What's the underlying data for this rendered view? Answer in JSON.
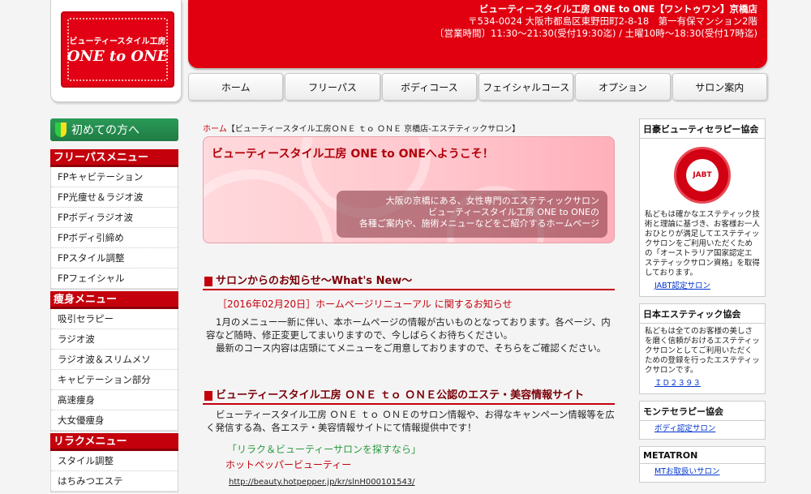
{
  "logo": {
    "sub": "ビューティースタイル工房",
    "main": "ONE to ONE"
  },
  "header": {
    "line1": "ビューティースタイル工房 ONE to ONE【ワントゥワン】京橋店",
    "line2": "〒534-0024 大阪市都島区東野田町2-8-18　第一有保マンション2階",
    "line3": "〔営業時間〕11:30～21:30(受付19:30迄) / 土曜10時～18:30(受付17時迄)"
  },
  "nav": [
    "ホーム",
    "フリーパス",
    "ボディコース",
    "フェイシャルコース",
    "オプション",
    "サロン案内"
  ],
  "sidebar": {
    "first_time": "初めての方へ",
    "menus": [
      {
        "title": "フリーパスメニュー",
        "items": [
          "FPキャビテーション",
          "FP光痩せ＆ラジオ波",
          "FPボディラジオ波",
          "FPボディ引締め",
          "FPスタイル調整",
          "FPフェイシャル"
        ]
      },
      {
        "title": "痩身メニュー",
        "items": [
          "吸引セラピー",
          "ラジオ波",
          "ラジオ波＆スリムメソ",
          "キャビテーション部分",
          "高速痩身",
          "大女優痩身"
        ]
      },
      {
        "title": "リラクメニュー",
        "items": [
          "スタイル調整",
          "はちみつエステ"
        ]
      }
    ]
  },
  "main": {
    "breadcrumb_home": "ホーム",
    "breadcrumb_rest": "【ビューティースタイル工房ＯＮＥ ｔｏ ＯＮＥ 京橋店-エステティックサロン】",
    "welcome_title": "ビューティースタイル工房 ONE to ONEへようこそ！",
    "welcome_lines": [
      "大阪の京橋にある、女性専門のエステティックサロン",
      "ビューティースタイル工房 ONE to ONEの",
      "各種ご案内や、施術メニューなどをご紹介するホームページ"
    ],
    "news_title": "サロンからのお知らせ～What's New～",
    "news_head": "［2016年02月20日］ホームページリニューアル に関するお知らせ",
    "news_body": [
      "1月のメニュー一新に伴い、本ホームページの情報が古いものとなっております。各ページ、内容など随時、修正変更してまいりますので、今しばらくお待ちください。",
      "最新のコース内容は店頭にてメニューをご用意しておりますので、そちらをご確認ください。"
    ],
    "info_title": "ビューティースタイル工房 ＯＮＥ ｔｏ ＯＮＥ公認のエステ・美容情報サイト",
    "info_body": "ビューティースタイル工房 ＯＮＥ ｔｏ ＯＮＥのサロン情報や、お得なキャンペーン情報等を広く発信する為、各エステ・美容情報サイトにて情報提供中です！",
    "link_caption": "「リラク＆ビューティーサロンを探すなら」",
    "link_name": "ホットペッパービューティー",
    "link_url": "http://beauty.hotpepper.jp/kr/slnH000101543/"
  },
  "right": [
    {
      "title": "日豪ビューティセラピー協会",
      "seal": "JABT",
      "body": "私どもは確かなエステティック技術と理論に基づき、お客様お一人おひとりが満足してエステティックサロンをご利用いただくための「オーストラリア国家認定エステティックサロン資格」を取得しております。",
      "link": "JABT認定サロン"
    },
    {
      "title": "日本エステティック協会",
      "body": "私どもは全てのお客様の美しさを磨く信頼がおけるエステティックサロンとしてご利用いただくための登録を行ったエステティックサロンです。",
      "link": "ＩＤ２３９３"
    },
    {
      "title": "モンテセラピー協会",
      "link": "ボディ認定サロン"
    },
    {
      "title": "METATRON",
      "link": "MTお取扱いサロン"
    }
  ],
  "colors": {
    "brand_red": "#e00010",
    "menu_red": "#c4000c",
    "green": "#1f7c43"
  }
}
